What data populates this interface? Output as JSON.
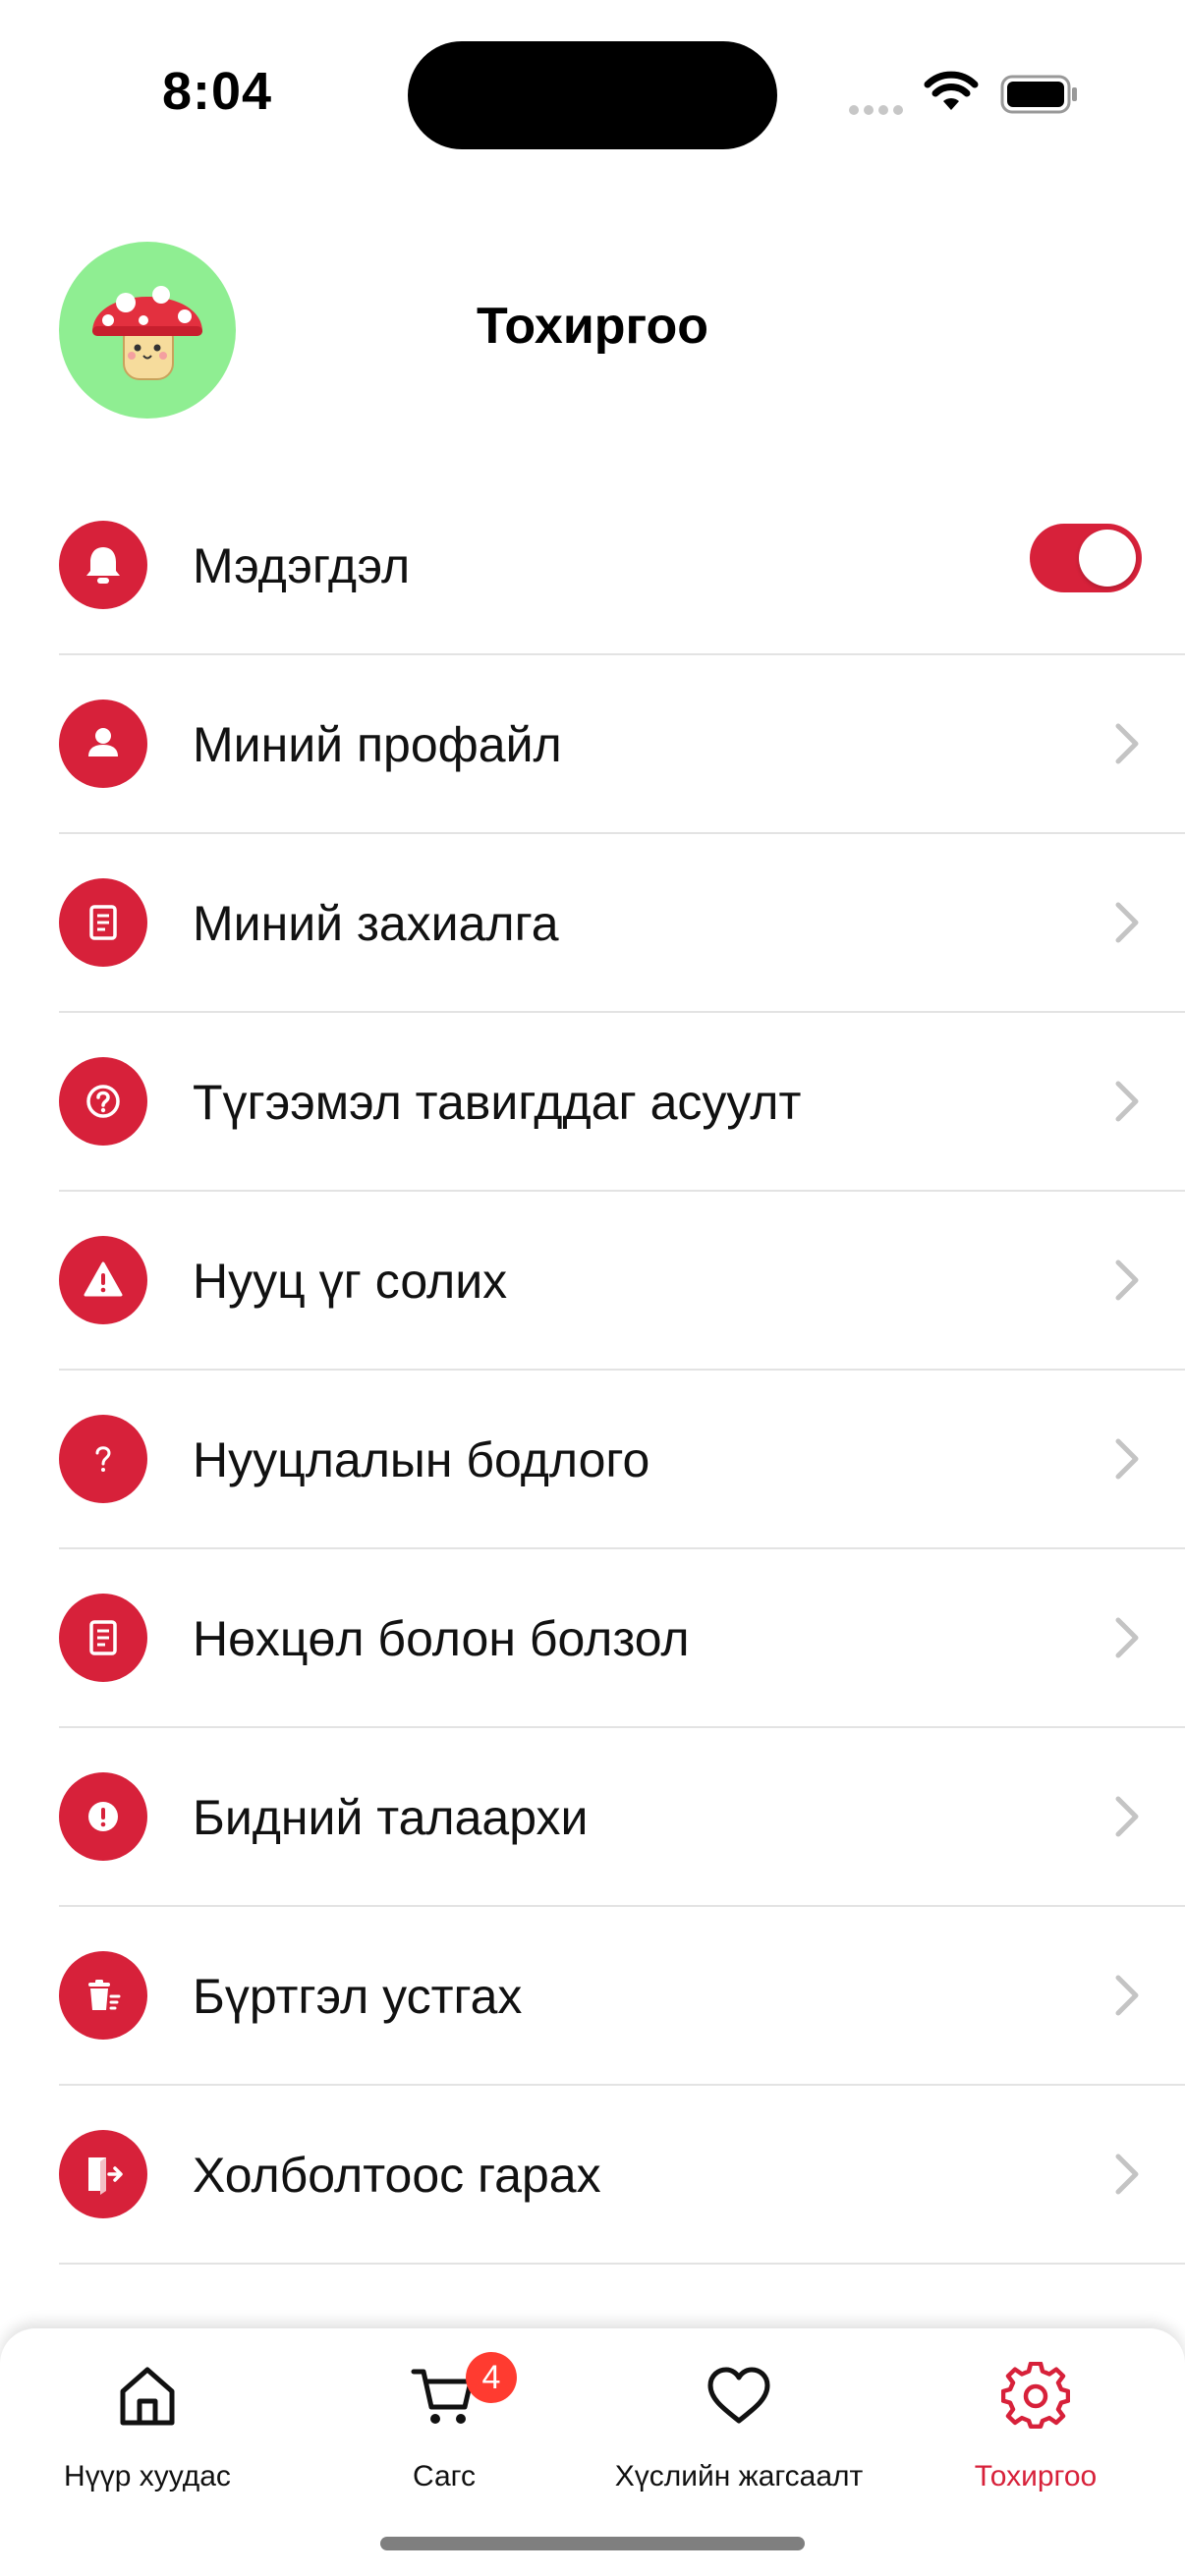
{
  "status_bar": {
    "time": "8:04"
  },
  "header": {
    "title": "Тохиргоо"
  },
  "settings": {
    "items": [
      {
        "label": "Мэдэгдэл",
        "icon": "bell-icon",
        "type": "toggle",
        "toggle_on": true
      },
      {
        "label": "Миний профайл",
        "icon": "user-icon",
        "type": "link"
      },
      {
        "label": "Миний захиалга",
        "icon": "document-icon",
        "type": "link"
      },
      {
        "label": "Түгээмэл тавигддаг асуулт",
        "icon": "question-circle-icon",
        "type": "link"
      },
      {
        "label": "Нууц үг солих",
        "icon": "warning-icon",
        "type": "link"
      },
      {
        "label": "Нууцлалын бодлого",
        "icon": "question-mark-icon",
        "type": "link"
      },
      {
        "label": "Нөхцөл болон болзол",
        "icon": "document-icon",
        "type": "link"
      },
      {
        "label": "Бидний талаархи",
        "icon": "exclamation-circle-icon",
        "type": "link"
      },
      {
        "label": "Бүртгэл устгах",
        "icon": "trash-icon",
        "type": "link"
      },
      {
        "label": "Холболтоос гарах",
        "icon": "logout-icon",
        "type": "link"
      }
    ]
  },
  "tab_bar": {
    "tabs": [
      {
        "label": "Нүүр хуудас",
        "icon": "home-icon",
        "active": false
      },
      {
        "label": "Сагс",
        "icon": "cart-icon",
        "active": false,
        "badge": "4"
      },
      {
        "label": "Хүслийн жагсаалт",
        "icon": "heart-icon",
        "active": false
      },
      {
        "label": "Тохиргоо",
        "icon": "gear-icon",
        "active": true
      }
    ]
  },
  "colors": {
    "accent": "#d7213a",
    "avatar_bg": "#8fee92",
    "badge": "#ff3b30"
  }
}
